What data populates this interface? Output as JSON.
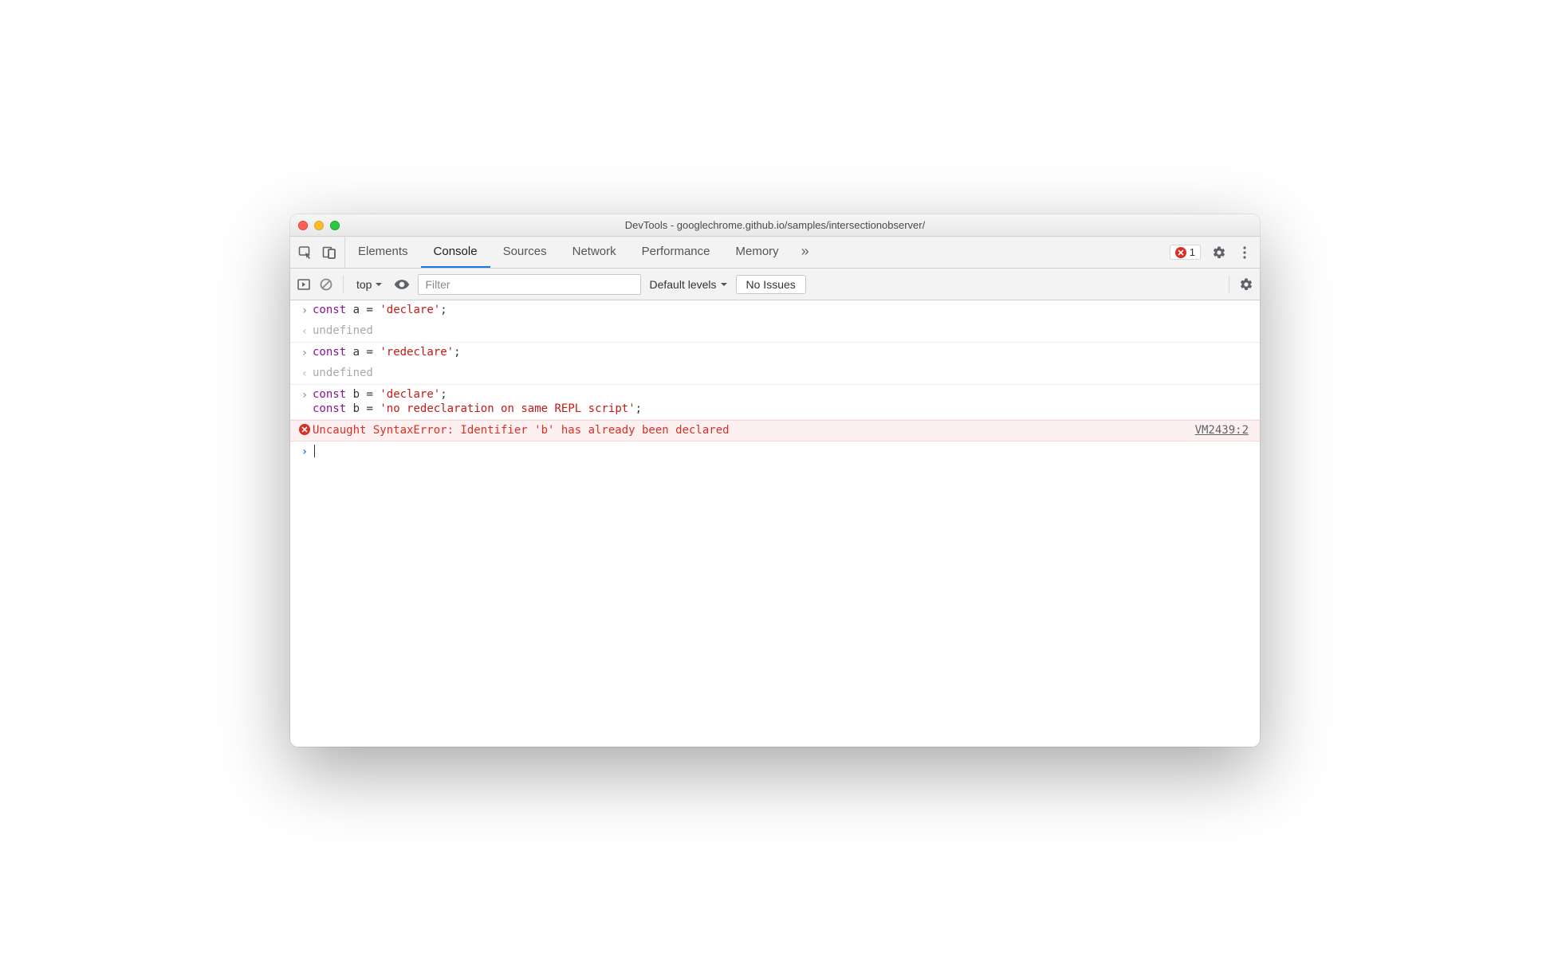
{
  "window": {
    "title": "DevTools - googlechrome.github.io/samples/intersectionobserver/"
  },
  "tabs": {
    "items": [
      "Elements",
      "Console",
      "Sources",
      "Network",
      "Performance",
      "Memory"
    ],
    "active": "Console",
    "overflow_glyph": "»"
  },
  "error_badge": {
    "count": "1"
  },
  "toolbar": {
    "context": "top",
    "filter_placeholder": "Filter",
    "filter_value": "",
    "levels_label": "Default levels",
    "issues_label": "No Issues"
  },
  "console": {
    "rows": [
      {
        "type": "input",
        "tokens": [
          {
            "t": "kw",
            "v": "const"
          },
          {
            "t": "sp",
            "v": " "
          },
          {
            "t": "var",
            "v": "a"
          },
          {
            "t": "sp",
            "v": " "
          },
          {
            "t": "op",
            "v": "="
          },
          {
            "t": "sp",
            "v": " "
          },
          {
            "t": "str",
            "v": "'declare'"
          },
          {
            "t": "semi",
            "v": ";"
          }
        ]
      },
      {
        "type": "output",
        "text": "undefined"
      },
      {
        "type": "input",
        "tokens": [
          {
            "t": "kw",
            "v": "const"
          },
          {
            "t": "sp",
            "v": " "
          },
          {
            "t": "var",
            "v": "a"
          },
          {
            "t": "sp",
            "v": " "
          },
          {
            "t": "op",
            "v": "="
          },
          {
            "t": "sp",
            "v": " "
          },
          {
            "t": "str",
            "v": "'redeclare'"
          },
          {
            "t": "semi",
            "v": ";"
          }
        ]
      },
      {
        "type": "output",
        "text": "undefined"
      },
      {
        "type": "input-multi",
        "lines": [
          [
            {
              "t": "kw",
              "v": "const"
            },
            {
              "t": "sp",
              "v": " "
            },
            {
              "t": "var",
              "v": "b"
            },
            {
              "t": "sp",
              "v": " "
            },
            {
              "t": "op",
              "v": "="
            },
            {
              "t": "sp",
              "v": " "
            },
            {
              "t": "str",
              "v": "'declare'"
            },
            {
              "t": "semi",
              "v": ";"
            }
          ],
          [
            {
              "t": "kw",
              "v": "const"
            },
            {
              "t": "sp",
              "v": " "
            },
            {
              "t": "var",
              "v": "b"
            },
            {
              "t": "sp",
              "v": " "
            },
            {
              "t": "op",
              "v": "="
            },
            {
              "t": "sp",
              "v": " "
            },
            {
              "t": "str",
              "v": "'no redeclaration on same REPL script'"
            },
            {
              "t": "semi",
              "v": ";"
            }
          ]
        ]
      },
      {
        "type": "error",
        "message": "Uncaught SyntaxError: Identifier 'b' has already been declared",
        "source": "VM2439:2"
      },
      {
        "type": "prompt"
      }
    ]
  },
  "colors": {
    "accent": "#1a73e8",
    "error": "#d93025",
    "error_bg": "#fdf0f0"
  }
}
